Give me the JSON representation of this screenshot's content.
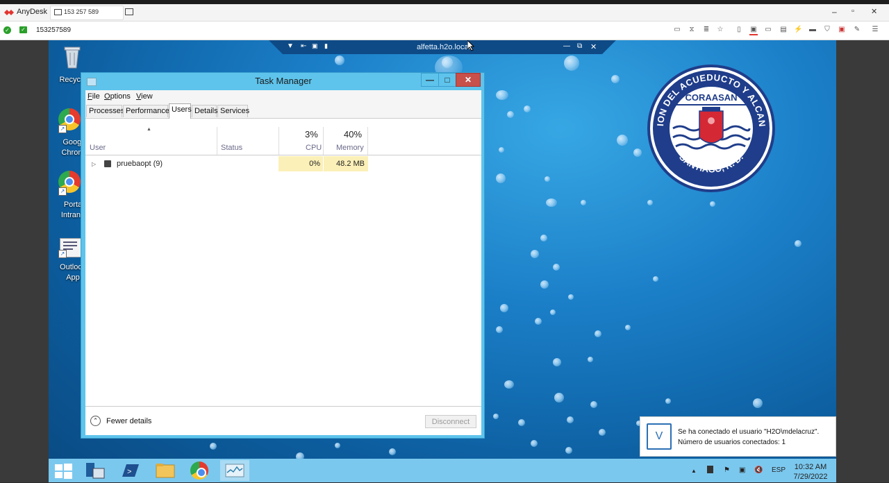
{
  "anydesk": {
    "brand": "AnyDesk",
    "tab_label": "153 257 589",
    "address_id": "153257589",
    "win_min": "–",
    "win_max": "▫",
    "win_close": "✕"
  },
  "session": {
    "title": "alfetta.h2o.local",
    "controls": [
      "▼",
      "⇤",
      "🔒",
      "📶",
      "—",
      "⧉",
      "✕"
    ]
  },
  "desktop": {
    "icons": [
      {
        "label": "Recycle"
      },
      {
        "label1": "Googl",
        "label2": "Chrom"
      },
      {
        "label1": "Porta",
        "label2": "Intrane"
      },
      {
        "label1": "Outlook",
        "label2": "App"
      }
    ]
  },
  "logo": {
    "top_text": "CORPORACION DEL ACUEDUCTO Y ALCANTARILLADO",
    "center_text": "CORAASAN",
    "bottom_text": "SANTIAGO, R. D."
  },
  "task_manager": {
    "title": "Task Manager",
    "menus": [
      {
        "key": "F",
        "rest": "ile"
      },
      {
        "key": "O",
        "rest": "ptions"
      },
      {
        "key": "V",
        "rest": "iew"
      }
    ],
    "tabs": [
      "Processes",
      "Performance",
      "Users",
      "Details",
      "Services"
    ],
    "active_tab": "Users",
    "columns": {
      "user": "User",
      "status": "Status",
      "cpu_pct": "3%",
      "cpu": "CPU",
      "mem_pct": "40%",
      "memory": "Memory"
    },
    "rows": [
      {
        "user": "pruebaopt (9)",
        "status": "",
        "cpu": "0%",
        "memory": "48.2 MB"
      }
    ],
    "fewer_details": "Fewer details",
    "disconnect": "Disconnect",
    "btn_min": "—",
    "btn_max": "□",
    "btn_close": "✕"
  },
  "notification": {
    "line1": "Se ha conectado el usuario \"H2O\\mdelacruz\".",
    "line2": "Número de usuarios conectados: 1"
  },
  "taskbar": {
    "lang": "ESP",
    "time": "10:32 AM",
    "date": "7/29/2022"
  },
  "colors": {
    "titlebar": "#5ec4ec",
    "close_btn": "#c7504b",
    "taskbar": "#7bc8ef",
    "highlight": "#fbf0b8"
  }
}
